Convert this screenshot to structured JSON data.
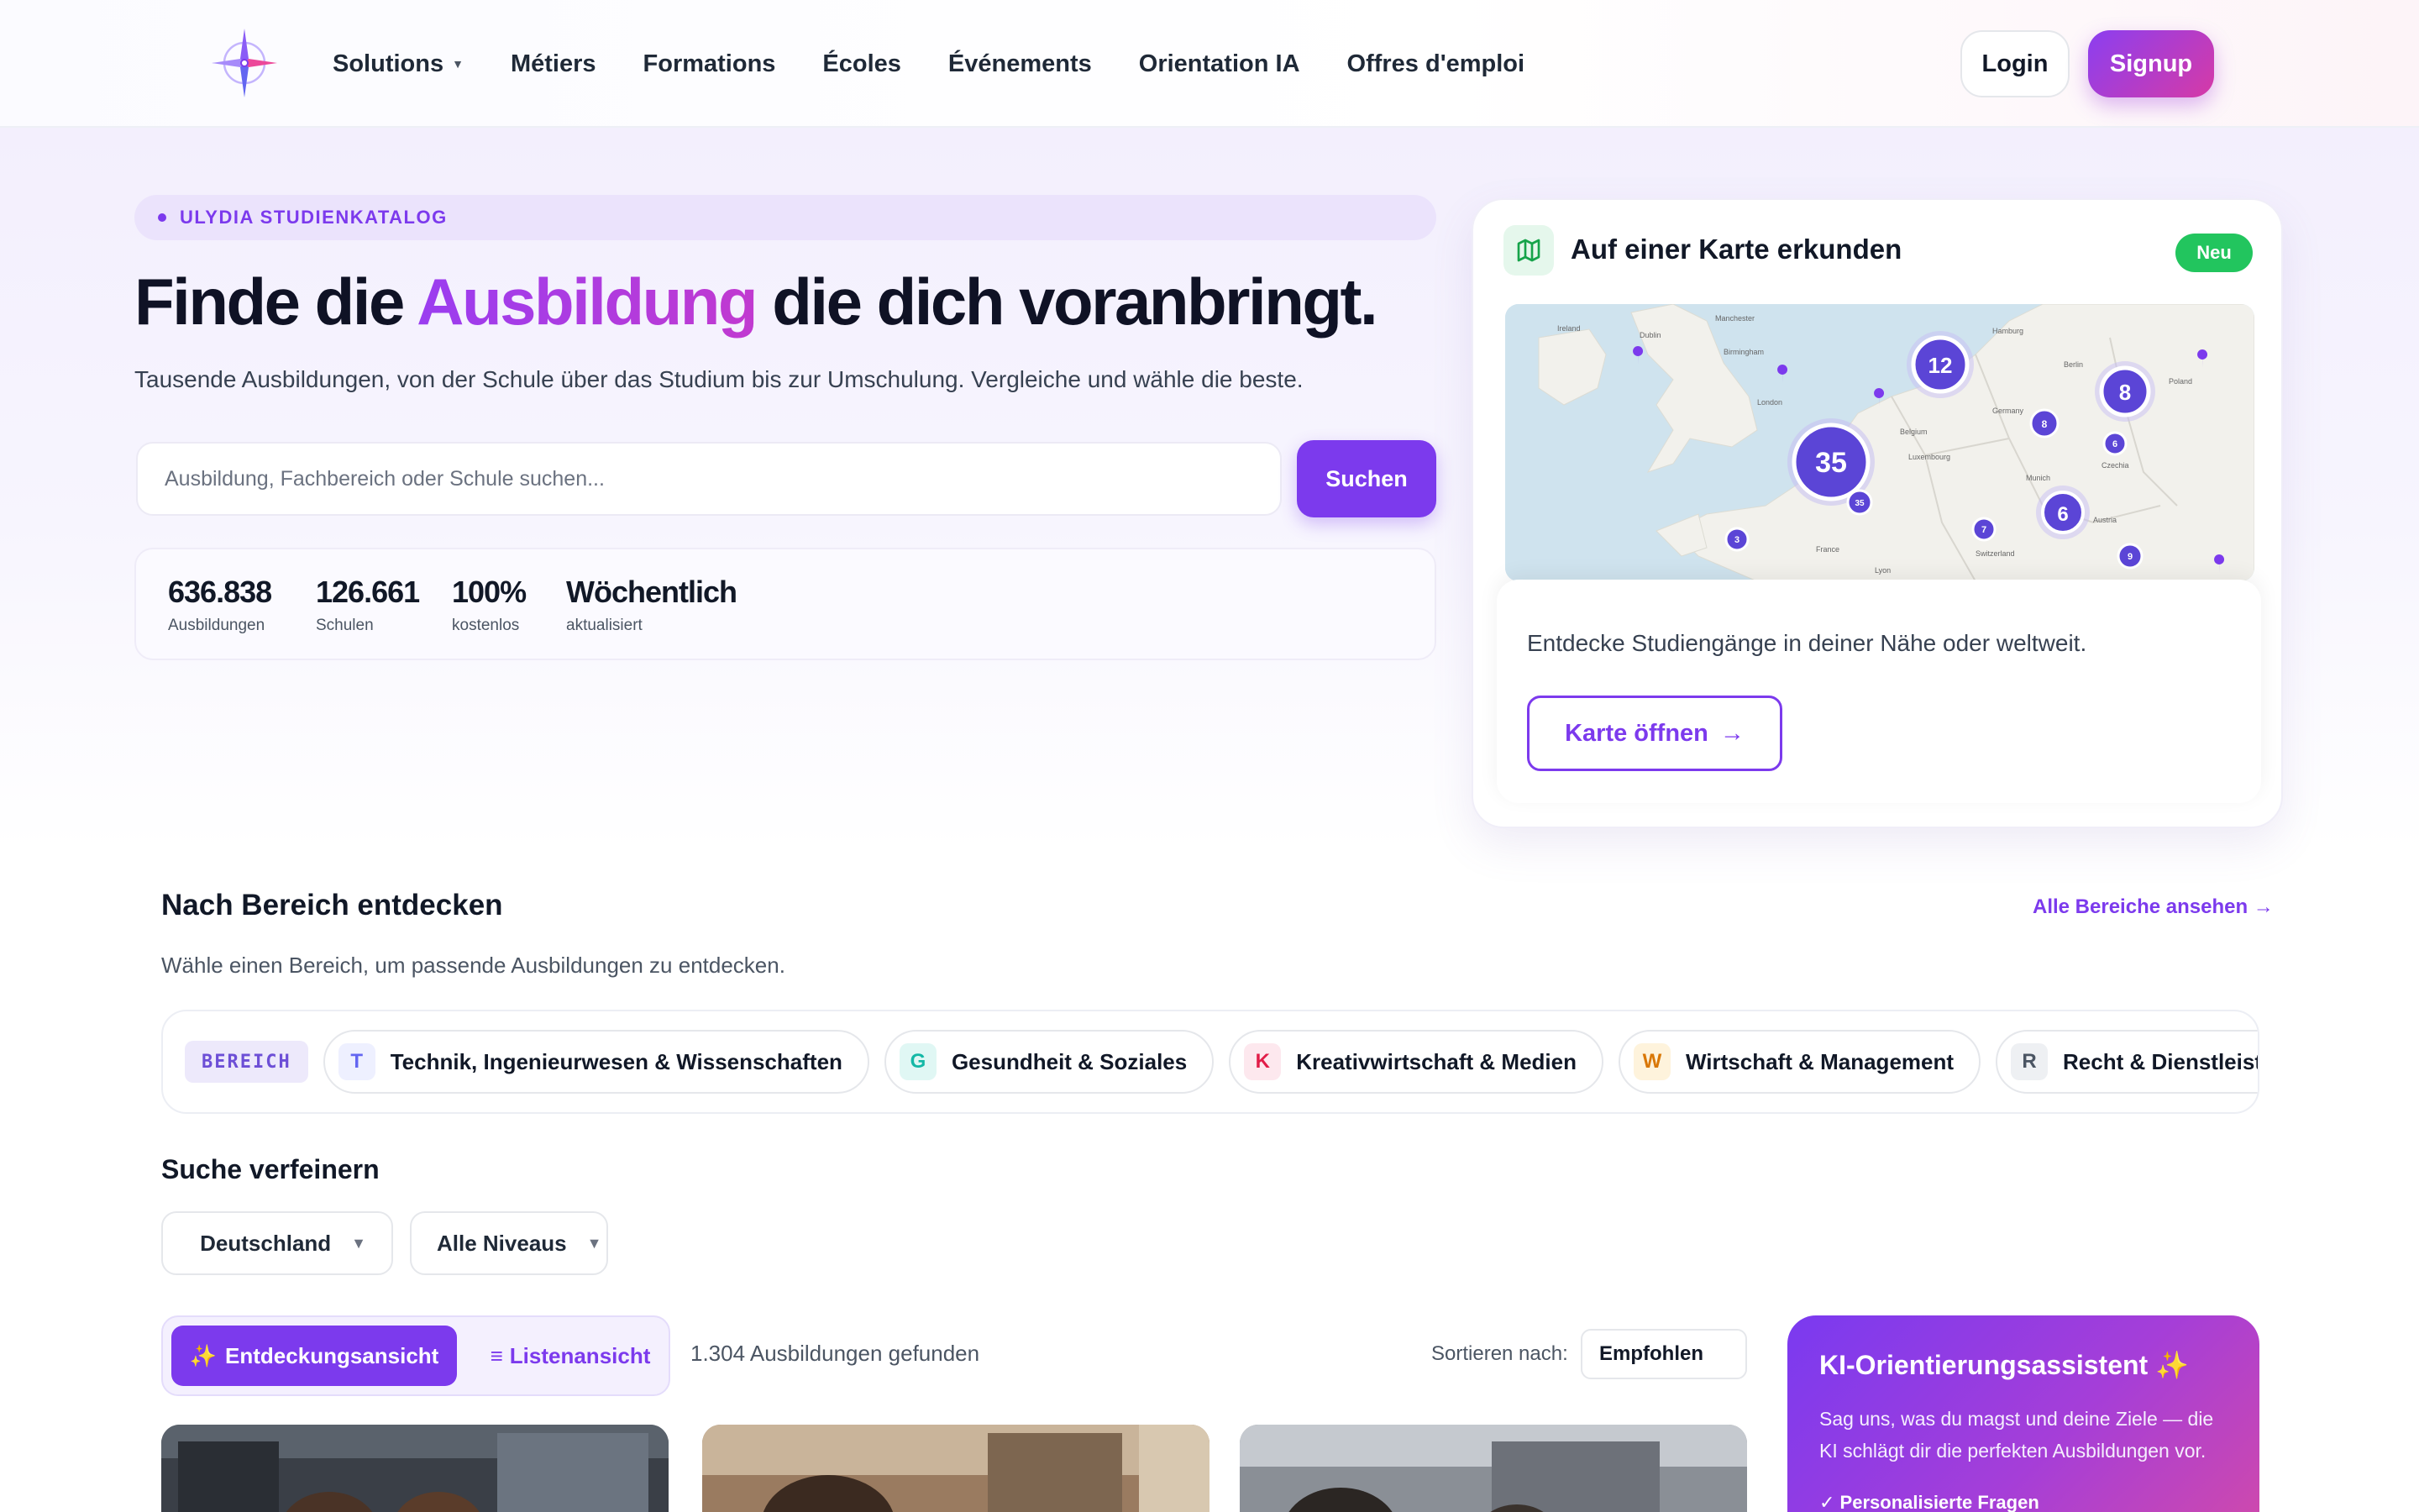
{
  "header": {
    "nav": [
      {
        "label": "Solutions",
        "has_dropdown": true
      },
      {
        "label": "Métiers"
      },
      {
        "label": "Formations"
      },
      {
        "label": "Écoles"
      },
      {
        "label": "Événements"
      },
      {
        "label": "Orientation IA"
      },
      {
        "label": "Offres d'emploi"
      }
    ],
    "login_label": "Login",
    "signup_label": "Signup",
    "logo_icon": "compass-rose-icon"
  },
  "hero": {
    "eyebrow": "ULYDIA STUDIENKATALOG",
    "title_before": "Finde die ",
    "title_accent": "Ausbildung",
    "title_after": " die dich voranbringt.",
    "subtitle": "Tausende Ausbildungen, von der Schule über das Studium bis zur Umschulung. Vergleiche und wähle die beste.",
    "search_placeholder": "Ausbildung, Fachbereich oder Schule suchen...",
    "search_button": "Suchen",
    "stats": [
      {
        "value": "636.838",
        "label": "Ausbildungen"
      },
      {
        "value": "126.661",
        "label": "Schulen"
      },
      {
        "value": "100%",
        "label": "kostenlos"
      },
      {
        "value": "Wöchentlich",
        "label": "aktualisiert"
      }
    ]
  },
  "map_card": {
    "title": "Auf einer Karte erkunden",
    "badge": "Neu",
    "description": "Entdecke Studiengänge in deiner Nähe oder weltweit.",
    "button": "Karte öffnen",
    "button_arrow": "→",
    "map_labels": [
      "Ireland",
      "Dublin",
      "Manchester",
      "Birmingham",
      "London",
      "Belgium",
      "Luxembourg",
      "Germany",
      "Hamburg",
      "Berlin",
      "Poland",
      "Czechia",
      "Munich",
      "Austria",
      "Switzerland",
      "France",
      "Lyon"
    ],
    "clusters": [
      {
        "count": "35",
        "size": "large"
      },
      {
        "count": "12",
        "size": "medium"
      },
      {
        "count": "8",
        "size": "medium"
      },
      {
        "count": "6",
        "size": "medium"
      },
      {
        "count": "8",
        "size": "small"
      },
      {
        "count": "6",
        "size": "small"
      },
      {
        "count": "35",
        "size": "small"
      },
      {
        "count": "7",
        "size": "small"
      },
      {
        "count": "3",
        "size": "small"
      },
      {
        "count": "9",
        "size": "small"
      }
    ],
    "colors": {
      "water": "#cfe3ee",
      "land": "#f2f1ec",
      "cluster": "#5b45d6"
    }
  },
  "discover": {
    "title": "Nach Bereich entdecken",
    "link": "Alle Bereiche ansehen →",
    "subtitle": "Wähle einen Bereich, um passende Ausbildungen zu entdecken.",
    "tag": "BEREICH",
    "chips": [
      {
        "letter": "T",
        "label": "Technik, Ingenieurwesen & Wissenschaften",
        "color": "#6366f1",
        "bg": "#eef0ff"
      },
      {
        "letter": "G",
        "label": "Gesundheit & Soziales",
        "color": "#14b8a6",
        "bg": "#e0f7f4"
      },
      {
        "letter": "K",
        "label": "Kreativwirtschaft & Medien",
        "color": "#e11d48",
        "bg": "#fde8ee"
      },
      {
        "letter": "W",
        "label": "Wirtschaft & Management",
        "color": "#d97706",
        "bg": "#fef3dc"
      },
      {
        "letter": "R",
        "label": "Recht & Dienstleistungen",
        "color": "#4b5563",
        "bg": "#eef0f3"
      }
    ]
  },
  "refine": {
    "title": "Suche verfeinern",
    "country": "Deutschland",
    "level": "Alle Niveaus"
  },
  "results": {
    "view_discovery": "Entdeckungsansicht",
    "view_discovery_icon": "✨",
    "view_list": "Listenansicht",
    "view_list_icon": "≡",
    "count_text": "1.304 Ausbildungen gefunden",
    "sort_label": "Sortieren nach:",
    "sort_value": "Empfohlen"
  },
  "ai_card": {
    "title": "KI-Orientierungsassistent",
    "title_icon": "✨",
    "text": "Sag uns, was du magst und deine Ziele — die KI schlägt dir die perfekten Ausbildungen vor.",
    "check_item": "✓ Personalisierte Fragen"
  },
  "colors": {
    "accent": "#7c3aed",
    "accent_pink": "#d63aa6",
    "success": "#22c55e"
  }
}
